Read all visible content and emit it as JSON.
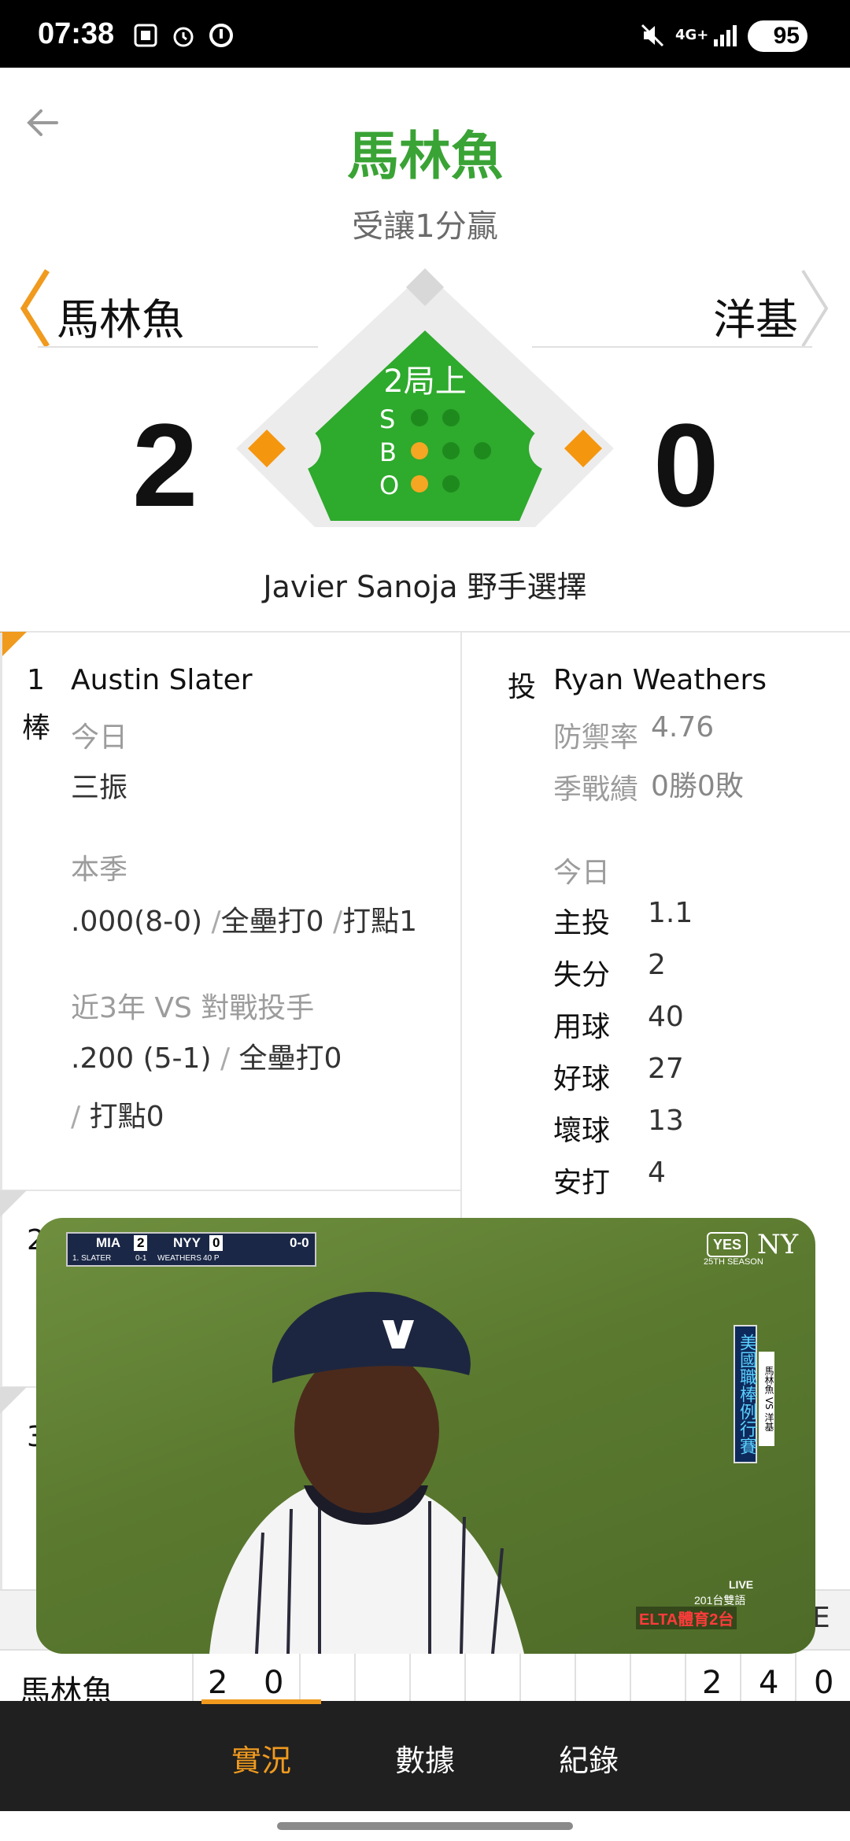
{
  "status_bar": {
    "time": "07:38",
    "battery": "95"
  },
  "header": {
    "title": "馬林魚",
    "subtitle": "受讓1分贏"
  },
  "scoreboard": {
    "away_team": "馬林魚",
    "home_team": "洋基",
    "away_score": "2",
    "home_score": "0",
    "inning": "2局上",
    "count_labels": {
      "s": "S",
      "b": "B",
      "o": "O"
    },
    "balls": 1,
    "strikes": 0,
    "outs": 1,
    "play_text": "Javier Sanoja 野手選擇"
  },
  "batter": {
    "order_num": "1",
    "order_suffix": "棒",
    "name": "Austin Slater",
    "today_label": "今日",
    "today_result": "三振",
    "season_label": "本季",
    "season_avg": ".000(8-0)",
    "season_sep1": "/",
    "season_hr": "全壘打0",
    "season_sep2": "/",
    "season_rbi": "打點1",
    "vs_label": "近3年 VS 對戰投手",
    "vs_avg": ".200 (5-1)",
    "vs_sep1": "/",
    "vs_hr": "全壘打0",
    "vs_sep2": "/",
    "vs_rbi": "打點0"
  },
  "other_batters": [
    "2",
    "3"
  ],
  "pitcher": {
    "label": "投",
    "name": "Ryan Weathers",
    "era_label": "防禦率",
    "era": "4.76",
    "record_label": "季戰績",
    "record": "0勝0敗",
    "today_label": "今日",
    "stats": [
      {
        "label": "主投",
        "value": "1.1"
      },
      {
        "label": "失分",
        "value": "2"
      },
      {
        "label": "用球",
        "value": "40"
      },
      {
        "label": "好球",
        "value": "27"
      },
      {
        "label": "壞球",
        "value": "13"
      },
      {
        "label": "安打",
        "value": "4"
      }
    ]
  },
  "linescore": {
    "e_header": "E",
    "team": "馬林魚",
    "innings": [
      "2",
      "0"
    ],
    "r": "2",
    "h": "4",
    "e": "0"
  },
  "video_overlay": {
    "away": "MIA",
    "away_score": "2",
    "home": "NYY",
    "home_score": "0",
    "count": "0-0",
    "batter": "1. SLATER",
    "batter_line": "0-1",
    "pitcher": "WEATHERS",
    "pitch_count": "40 P",
    "network": "YES",
    "season_tag": "25TH SEASON",
    "side_banner": "美國職棒例行賽",
    "side_match": "馬林魚 VS 洋基",
    "live": "LIVE",
    "channel_note": "201台雙語",
    "channel": "ELTA體育2台"
  },
  "bottom_nav": {
    "tabs": [
      "實況",
      "數據",
      "紀錄"
    ],
    "active": 0
  },
  "colors": {
    "accent_green": "#3aa335",
    "accent_orange": "#f09a1e",
    "field_green": "#2eaa2c"
  }
}
